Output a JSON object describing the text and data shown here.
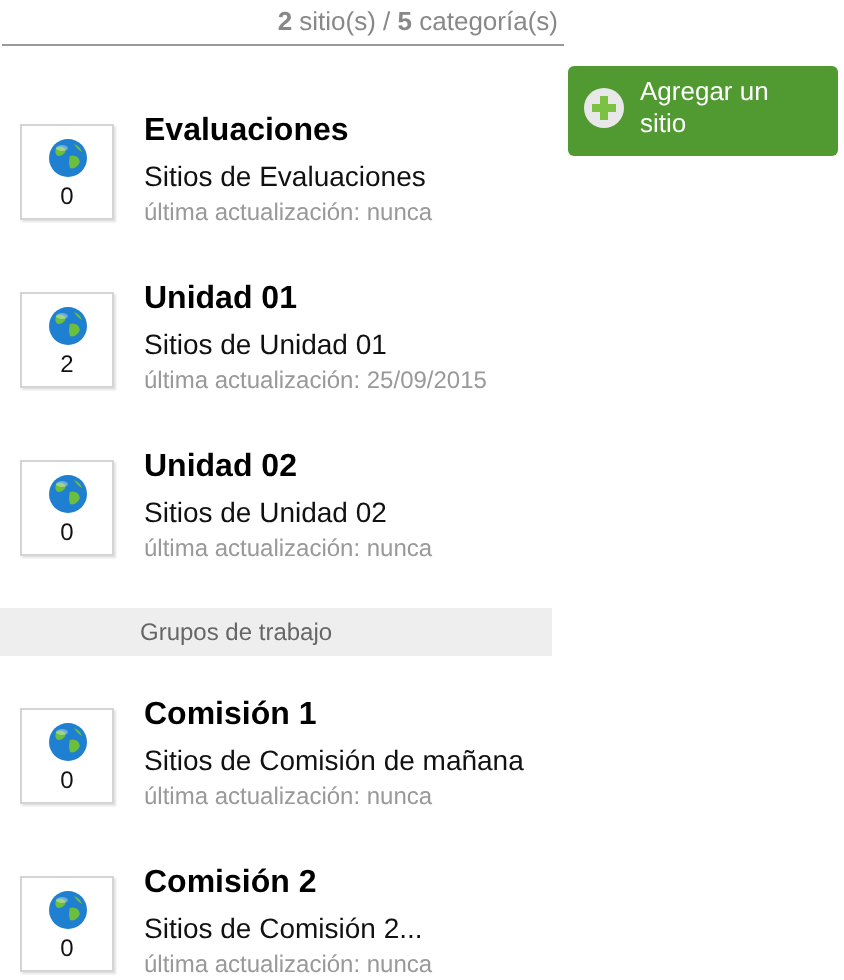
{
  "summary": "**2** sitio(s) / **5** categoría(s)",
  "add_button": {
    "label": "Agregar un sitio"
  },
  "sections": [
    {
      "kind": "items",
      "items": [
        {
          "count": "0",
          "title": "Evaluaciones",
          "subtitle": "Sitios de Evaluaciones",
          "updated": "última actualización: nunca"
        },
        {
          "count": "2",
          "title": "Unidad 01",
          "subtitle": "Sitios de Unidad 01",
          "updated": "última actualización: 25/09/2015"
        },
        {
          "count": "0",
          "title": "Unidad 02",
          "subtitle": "Sitios de Unidad 02",
          "updated": "última actualización: nunca"
        }
      ]
    },
    {
      "kind": "group",
      "label": "Grupos de trabajo"
    },
    {
      "kind": "items",
      "items": [
        {
          "count": "0",
          "title": "Comisión 1",
          "subtitle": "Sitios de Comisión de mañana",
          "updated": "última actualización: nunca"
        },
        {
          "count": "0",
          "title": "Comisión 2",
          "subtitle": "Sitios de Comisión 2...",
          "updated": "última actualización: nunca"
        }
      ]
    }
  ]
}
